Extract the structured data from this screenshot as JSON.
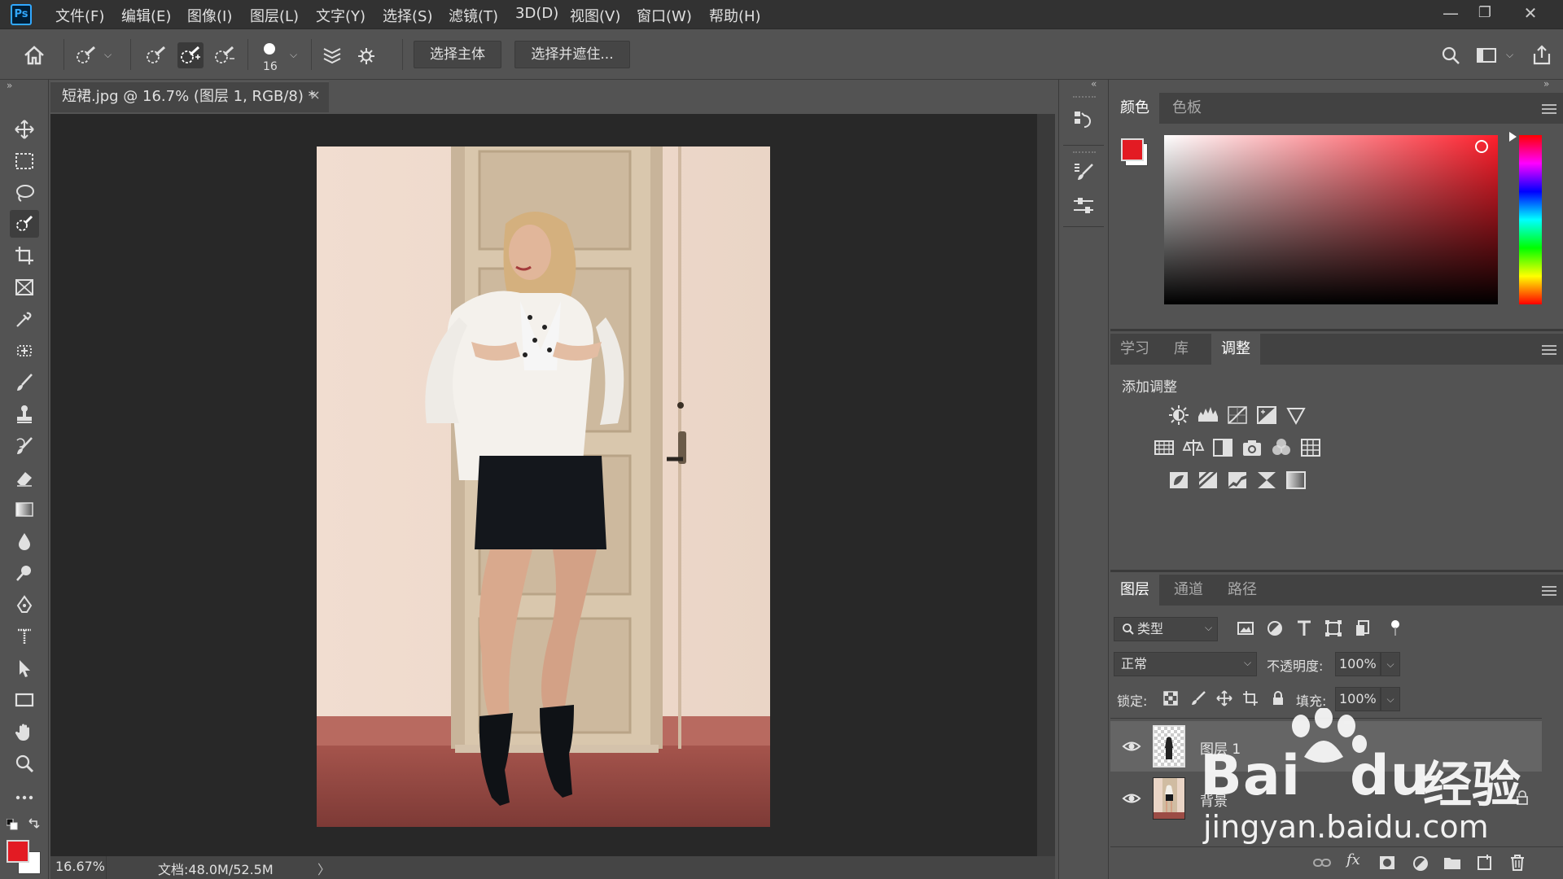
{
  "app": {
    "logo": "Ps"
  },
  "menu": [
    "文件(F)",
    "编辑(E)",
    "图像(I)",
    "图层(L)",
    "文字(Y)",
    "选择(S)",
    "滤镜(T)",
    "3D(D)",
    "视图(V)",
    "窗口(W)",
    "帮助(H)"
  ],
  "window_controls": {
    "minimize": "—",
    "restore": "❐",
    "close": "✕"
  },
  "options": {
    "brush_size": "16",
    "select_subject": "选择主体",
    "select_and_mask": "选择并遮住..."
  },
  "document": {
    "tab_title": "短裙.jpg @ 16.7% (图层 1, RGB/8) *",
    "close": "×",
    "zoom": "16.67%",
    "doc_size": "文档:48.0M/52.5M",
    "status_arrow": "〉"
  },
  "color_panel": {
    "tabs": [
      "颜色",
      "色板"
    ],
    "foreground": "#e31b23",
    "background": "#ffffff"
  },
  "adjust_panel": {
    "tabs": [
      "学习",
      "库",
      "调整"
    ],
    "heading": "添加调整"
  },
  "layers_panel": {
    "tabs": [
      "图层",
      "通道",
      "路径"
    ],
    "filter_kind": "类型",
    "blend_mode": "正常",
    "opacity_label": "不透明度:",
    "opacity_value": "100%",
    "lock_label": "锁定:",
    "fill_label": "填充:",
    "fill_value": "100%",
    "layers": [
      {
        "name": "图层 1"
      },
      {
        "name": "背景"
      }
    ],
    "footer_fx": "fx"
  },
  "watermark": {
    "brand": "Bai",
    "brand2": "du",
    "cn": "经验",
    "url": "jingyan.baidu.com"
  }
}
